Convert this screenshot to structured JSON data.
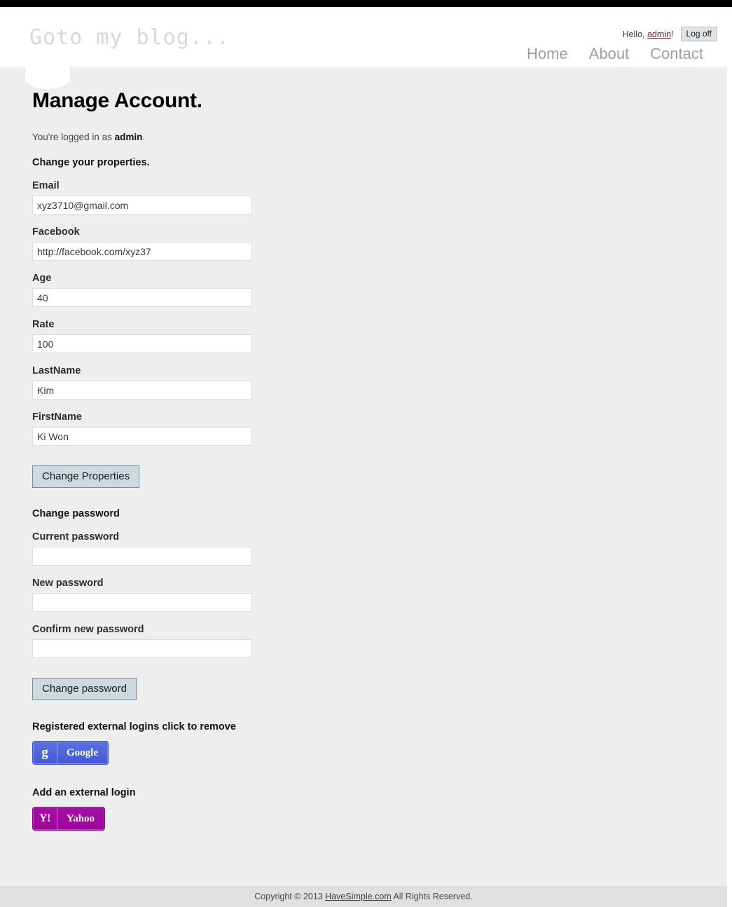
{
  "header": {
    "logo_text": "Goto my blog...",
    "hello_prefix": "Hello, ",
    "user_name": "admin",
    "hello_suffix": "!",
    "logoff_label": "Log off",
    "nav": [
      {
        "label": "Home"
      },
      {
        "label": "About"
      },
      {
        "label": "Contact"
      }
    ]
  },
  "main": {
    "page_title": "Manage Account.",
    "logged_in_prefix": "You're logged in as ",
    "logged_in_user": "admin",
    "logged_in_suffix": ".",
    "properties_section_title": "Change your properties.",
    "property_fields": [
      {
        "label": "Email",
        "value": "xyz3710@gmail.com",
        "placeholder": ""
      },
      {
        "label": "Facebook",
        "value": "http://facebook.com/xyz37",
        "placeholder": ""
      },
      {
        "label": "Age",
        "value": "40",
        "placeholder": ""
      },
      {
        "label": "Rate",
        "value": "100",
        "placeholder": ""
      },
      {
        "label": "LastName",
        "value": "Kim",
        "placeholder": ""
      },
      {
        "label": "FirstName",
        "value": "Ki Won",
        "placeholder": ""
      }
    ],
    "change_properties_label": "Change Properties",
    "password_section_title": "Change password",
    "password_fields": [
      {
        "label": "Current password",
        "value": "",
        "placeholder": ""
      },
      {
        "label": "New password",
        "value": "",
        "placeholder": ""
      },
      {
        "label": "Confirm new password",
        "value": "",
        "placeholder": ""
      }
    ],
    "change_password_label": "Change password",
    "registered_logins_title": "Registered external logins click to remove",
    "registered_logins": [
      {
        "name": "Google",
        "glyph": "g",
        "icon": "google-icon",
        "color": "#4458d4"
      }
    ],
    "add_login_title": "Add an external login",
    "add_logins": [
      {
        "name": "Yahoo",
        "glyph": "Y!",
        "icon": "yahoo-icon",
        "color": "#a80ca8"
      }
    ]
  },
  "footer": {
    "copyright_prefix": "Copyright © 2013 ",
    "link_label": "HaveSimple.com",
    "copyright_suffix": " All Rights Reserved."
  },
  "theme": {
    "page_background": "#eeeeee",
    "header_background": "#ffffff",
    "footer_background": "#e0e0e0",
    "nav_link_color": "#999fa8",
    "logo_color": "#d8d8d8",
    "button_background": "#cfd9dd"
  }
}
